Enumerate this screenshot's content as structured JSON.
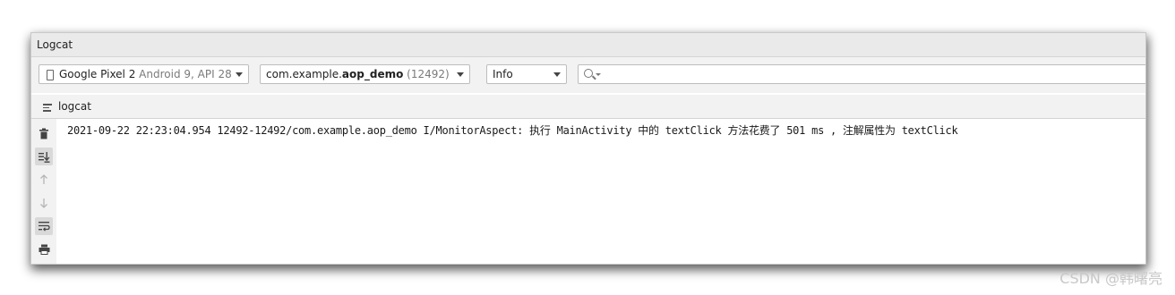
{
  "window": {
    "title": "Logcat"
  },
  "toolbar": {
    "device": {
      "name": "Google Pixel 2",
      "detail": "Android 9, API 28"
    },
    "process": {
      "prefix": "com.example.",
      "name": "aop_demo",
      "pid": "(12492)"
    },
    "level": "Info",
    "search": {
      "value": ""
    }
  },
  "tab": {
    "label": "logcat"
  },
  "log": {
    "lines": [
      "2021-09-22 22:23:04.954 12492-12492/com.example.aop_demo I/MonitorAspect: 执行 MainActivity 中的 textClick 方法花费了 501 ms , 注解属性为 textClick"
    ]
  },
  "watermark": "CSDN @韩曙亮"
}
